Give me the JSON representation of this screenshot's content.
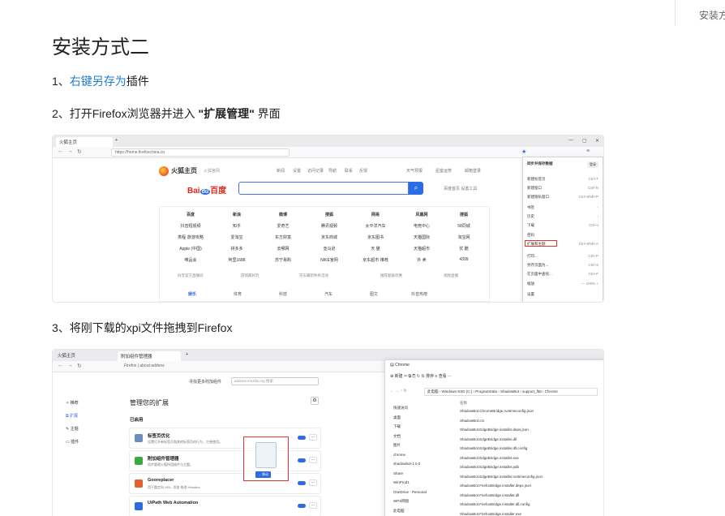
{
  "toc": {
    "label": "安装方"
  },
  "page": {
    "title": "安装方式二",
    "step1": {
      "prefix": "1、",
      "link": "右键另存为",
      "suffix": "插件"
    },
    "step2": {
      "prefix": "2、打开Firefox浏览器并进入 ",
      "bold": "\"扩展管理\"",
      "suffix": " 界面"
    },
    "step3": {
      "text": "3、将刚下载的xpi文件拖拽到Firefox"
    }
  },
  "shot1": {
    "tab": "火狐主页",
    "url": "https://home.firefoxchina.cn",
    "brand": "火狐主页",
    "brand_sub": "火狐官网",
    "nav": [
      "新闻",
      "设置",
      "访问记录",
      "导航",
      "联系",
      "反馈"
    ],
    "nav_right": [
      "天气预报",
      "星座运势",
      "邮箱登录"
    ],
    "baidu_text": "Bai",
    "baidu_du": "du",
    "baidu_cn": "百度",
    "baidu_right": "百度首页  设置工具",
    "sites": [
      [
        "百度",
        "新浪",
        "微博",
        "搜狐",
        "网易",
        "凤凰网",
        "搜狐"
      ],
      [
        "抖音短视频",
        "知乎",
        "爱奇艺",
        "腾讯视频",
        "太平洋汽车",
        "电竞中心",
        "58同城"
      ],
      [
        "携程·旅游攻略",
        "爱淘宝",
        "东方财富",
        "京东商城",
        "京东图书",
        "天猫国际",
        "淘宝网"
      ],
      [
        "Apple (中国)",
        "拼多多",
        "去哪网",
        "亚马逊",
        "天 猫",
        "天猫超市",
        "优 酷"
      ],
      [
        "唯品会",
        "阿里1688",
        "苏宁易购",
        "NIKE官网",
        "京东超市·推荐",
        "外 卖",
        "4399"
      ]
    ],
    "utilities": [
      "抖音官方直播间",
      "游戏最好玩",
      "京东最新秒杀活动",
      "推荐超级优惠",
      "视频直播"
    ],
    "categories": [
      "娱乐",
      "体育",
      "科技",
      "汽车",
      "图文",
      "抖音热榜"
    ],
    "menu": {
      "header": "同步并保存数据",
      "sync": "登录",
      "items": [
        {
          "label": "新建标签页",
          "key": "Ctrl+T"
        },
        {
          "label": "新建窗口",
          "key": "Ctrl+N"
        },
        {
          "label": "新建隐私窗口",
          "key": "Ctrl+Shift+P"
        },
        {
          "label": "书签",
          "key": "›"
        },
        {
          "label": "历史",
          "key": "›"
        },
        {
          "label": "下载",
          "key": "Ctrl+J"
        },
        {
          "label": "密码",
          "key": ""
        },
        {
          "label": "扩展和主题",
          "key": "Ctrl+Shift+A"
        },
        {
          "label": "打印...",
          "key": "Ctrl+P"
        },
        {
          "label": "另存页面为...",
          "key": "Ctrl+S"
        },
        {
          "label": "在页面中查找...",
          "key": "Ctrl+F"
        },
        {
          "label": "缩放",
          "key": "— 100% +"
        },
        {
          "label": "设置",
          "key": ""
        }
      ]
    }
  },
  "shot2": {
    "tab1": "火狐主页",
    "tab2": "附加组件管理器",
    "url_prefix": "Firefox",
    "url": "about:addons",
    "search_label": "寻找更多附加组件",
    "search_placeholder": "addons.mozilla.org 搜索",
    "sidebar": [
      "推荐",
      "扩展",
      "主题",
      "插件"
    ],
    "manage_title": "管理您的扩展",
    "enabled_label": "已启用",
    "extensions": [
      {
        "name": "标签页优化",
        "desc": "设置打开新标签页和其他标签页的行为、方便使用。",
        "color": "#6a8fbf"
      },
      {
        "name": "附加组件管理器",
        "desc": "同步管理火狐所用插件与主题。",
        "color": "#3caa3c"
      },
      {
        "name": "Gooreplacer",
        "desc": "用于重定向 URL, 添加 修改 Headers",
        "color": "#e0612b"
      },
      {
        "name": "UiPath Web Automation",
        "desc": "",
        "color": "#2b6be3"
      }
    ],
    "drop_label": "→ 移动",
    "explorer": {
      "title": "Chrome",
      "toolbar": "⊕ 新建   ✂   ⧉   ⎘   ↻   ⇅ 排序   ≡ 查看   ⋯",
      "path": "此电脑 › Windows-SSD (C:) › ProgramData › ShadowBot › support_f68 › Chrome",
      "col_header": "名称",
      "tree": [
        "快速访问",
        "桌面",
        "下载",
        "文档",
        "图片",
        "chrome",
        "shadowbot-1.0.0",
        "Share",
        "WinProd1",
        "OneDrive - Personal",
        "WPS网盘",
        "此电脑"
      ],
      "files": [
        "ShadowBot.ChromeBridge.runtimeconfig.json",
        "ShadowBot.crx",
        "ShadowBot.EdgeBridge.installer.deps.json",
        "ShadowBot.EdgeBridge.installer.dll",
        "ShadowBot.EdgeBridge.installer.dll.config",
        "ShadowBot.EdgeBridge.installer.exe",
        "ShadowBot.EdgeBridge.installer.pdb",
        "ShadowBot.EdgeBridge.installer.runtimeconfig.json",
        "ShadowBot.FirefoxBridge.installer.deps.json",
        "ShadowBot.FirefoxBridge.installer.dll",
        "ShadowBot.FirefoxBridge.installer.dll.config",
        "ShadowBot.FirefoxBridge.installer.exe"
      ]
    }
  }
}
